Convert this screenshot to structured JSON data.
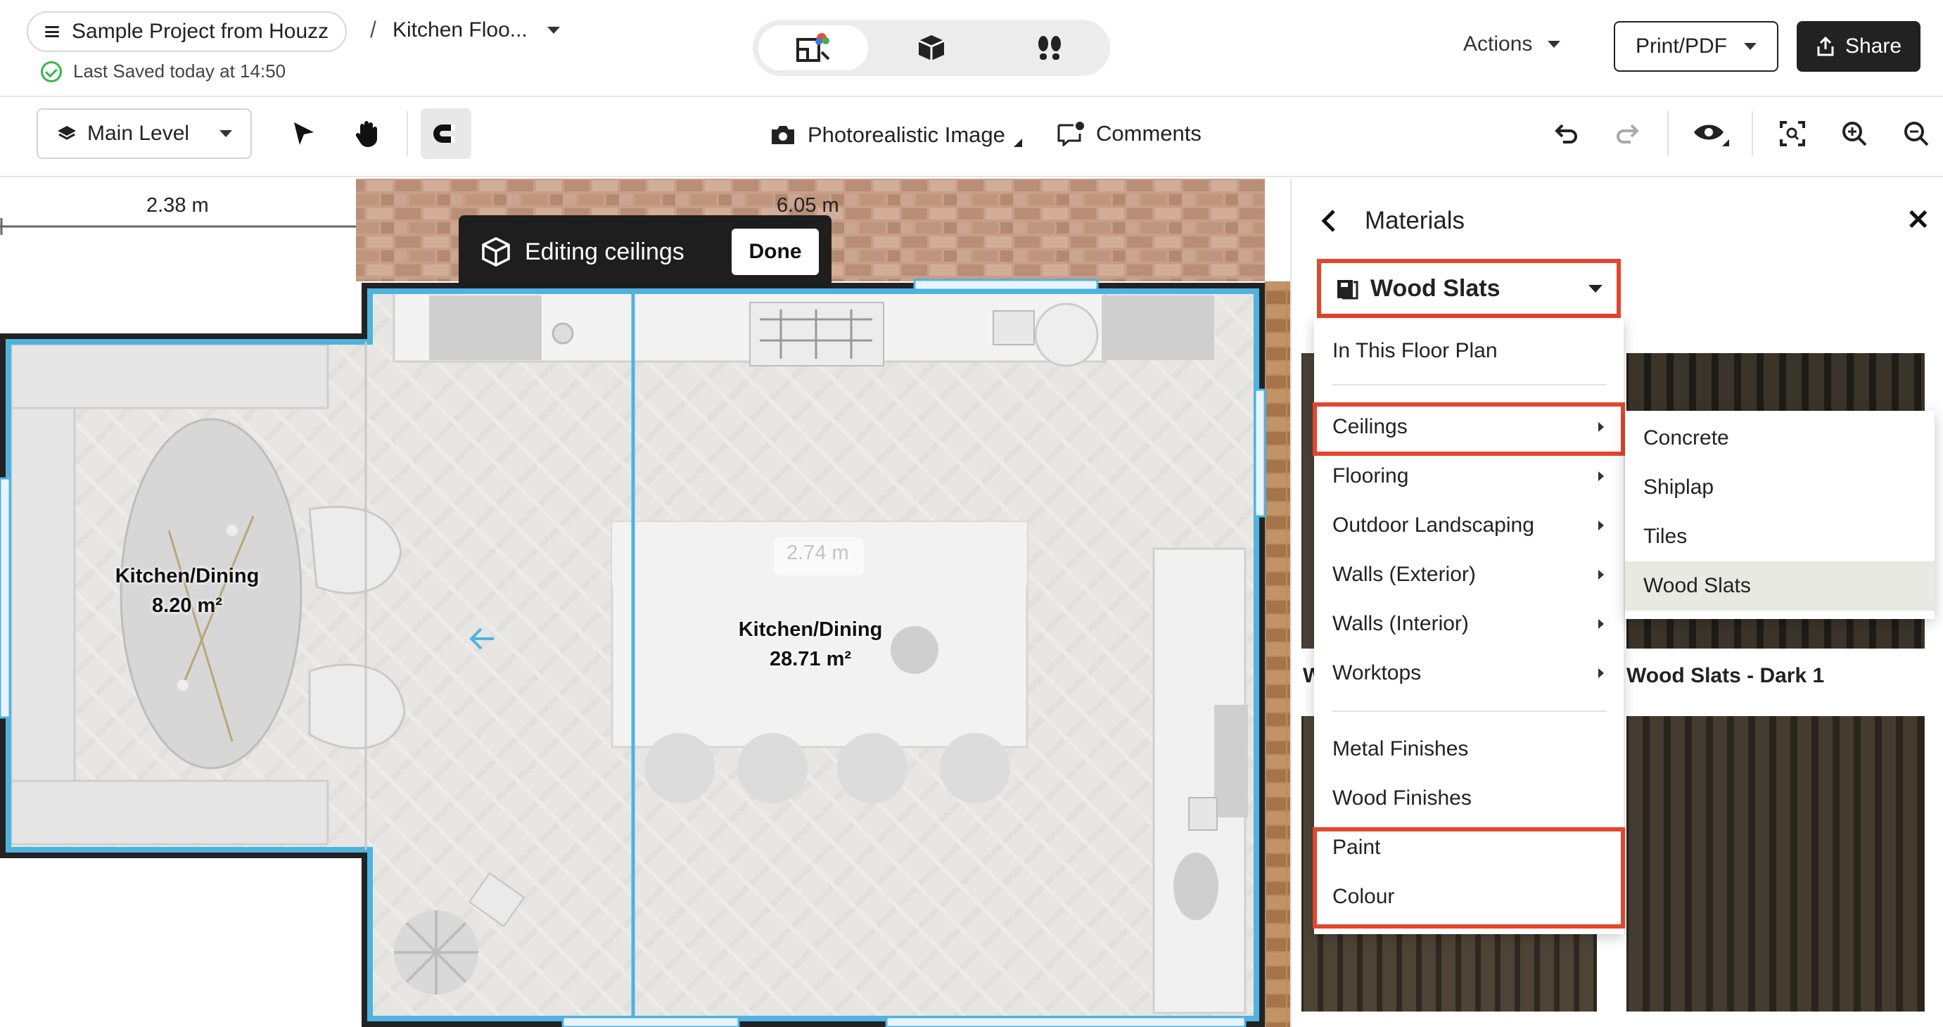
{
  "header": {
    "project_name": "Sample Project from Houzz",
    "breadcrumb_separator": "/",
    "document_title": "Kitchen Floo...",
    "save_status": "Last Saved today at 14:50",
    "actions_label": "Actions",
    "print_label": "Print/PDF",
    "share_label": "Share"
  },
  "view_modes": [
    {
      "icon": "2d-floor-plan-icon",
      "active": true
    },
    {
      "icon": "3d-cube-icon",
      "active": false
    },
    {
      "icon": "walkthrough-footprints-icon",
      "active": false
    }
  ],
  "toolbar": {
    "level": "Main Level",
    "photoreal_label": "Photorealistic Image",
    "comments_label": "Comments"
  },
  "canvas": {
    "editing_label": "Editing ceilings",
    "done_label": "Done",
    "dim_top_left": "2.38 m",
    "dim_top_wall": "6.05 m",
    "dim_island": "2.74 m",
    "rooms": [
      {
        "name": "Kitchen/Dining",
        "area": "8.20 m²"
      },
      {
        "name": "Kitchen/Dining",
        "area": "28.71 m²"
      }
    ]
  },
  "materials_panel": {
    "title": "Materials",
    "selected_category": "Wood Slats",
    "menu": {
      "top_item": "In This Floor Plan",
      "groups": [
        {
          "label": "Ceilings",
          "has_submenu": true,
          "highlighted": true
        },
        {
          "label": "Flooring",
          "has_submenu": true
        },
        {
          "label": "Outdoor Landscaping",
          "has_submenu": true
        },
        {
          "label": "Walls (Exterior)",
          "has_submenu": true
        },
        {
          "label": "Walls (Interior)",
          "has_submenu": true
        },
        {
          "label": "Worktops",
          "has_submenu": true
        }
      ],
      "finishes": [
        "Metal Finishes",
        "Wood Finishes"
      ],
      "highlighted_items": [
        "Paint",
        "Colour"
      ]
    },
    "submenu": [
      "Concrete",
      "Shiplap",
      "Tiles",
      "Wood Slats"
    ],
    "submenu_selected": "Wood Slats",
    "tiles": [
      {
        "label": "W"
      },
      {
        "label": "Wood Slats - Dark 1"
      }
    ]
  },
  "colors": {
    "highlight_red": "#e2462f",
    "room_outline_blue": "#4fb3e0",
    "accent_dark": "#222222",
    "saved_green": "#3bb54a"
  }
}
